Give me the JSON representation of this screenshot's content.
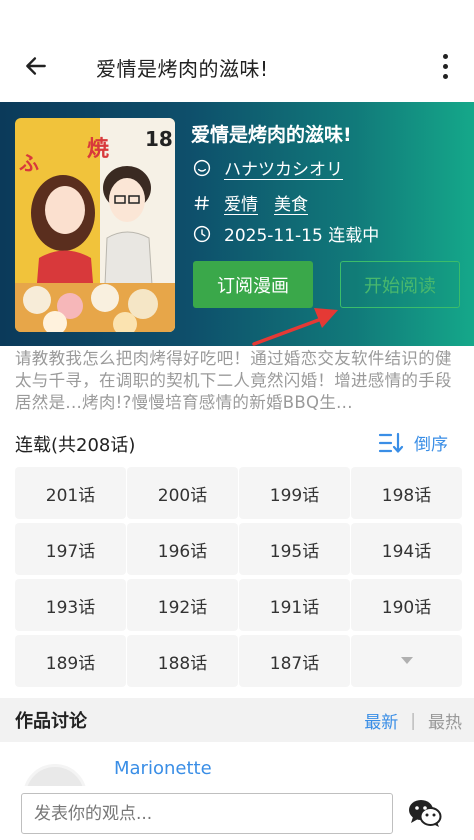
{
  "header": {
    "title": "爱情是烤肉的滋味!"
  },
  "comic": {
    "title": "爱情是烤肉的滋味!",
    "author": "ハナツカシオリ",
    "tags": [
      "爱情",
      "美食"
    ],
    "status": "2025-11-15 连载中",
    "cover_text": {
      "vertical_title": "焼いてるふたり",
      "volume": "18",
      "author_kana": "ハナツカシオリ"
    },
    "subscribe_label": "订阅漫画",
    "read_label": "开始阅读",
    "description": "请教教我怎么把肉烤得好吃吧！通过婚恋交友软件结识的健太与千寻，在调职的契机下二人竟然闪婚！增进感情的手段居然是...烤肉!?慢慢培育感情的新婚BBQ生..."
  },
  "chapters": {
    "heading": "连载(共208话)",
    "sort_label": "倒序",
    "items": [
      "201话",
      "200话",
      "199话",
      "198话",
      "197话",
      "196话",
      "195话",
      "194话",
      "193话",
      "192话",
      "191话",
      "190话",
      "189话",
      "188话",
      "187话"
    ]
  },
  "discussion": {
    "title": "作品讨论",
    "tab_latest": "最新",
    "separator": "|",
    "tab_hot": "最热",
    "first_user": "Marionette"
  },
  "comment": {
    "placeholder": "发表你的观点..."
  },
  "colors": {
    "accent_blue": "#3a8ee6",
    "subscribe_green": "#3aa84a",
    "banner_start": "#0b3a5a",
    "banner_end": "#15a88a",
    "annotation_red": "#e53935"
  },
  "icons": [
    "back-arrow-icon",
    "more-vert-icon",
    "smile-icon",
    "hash-icon",
    "clock-icon",
    "sort-desc-icon",
    "chevron-down-icon",
    "wechat-icon"
  ]
}
